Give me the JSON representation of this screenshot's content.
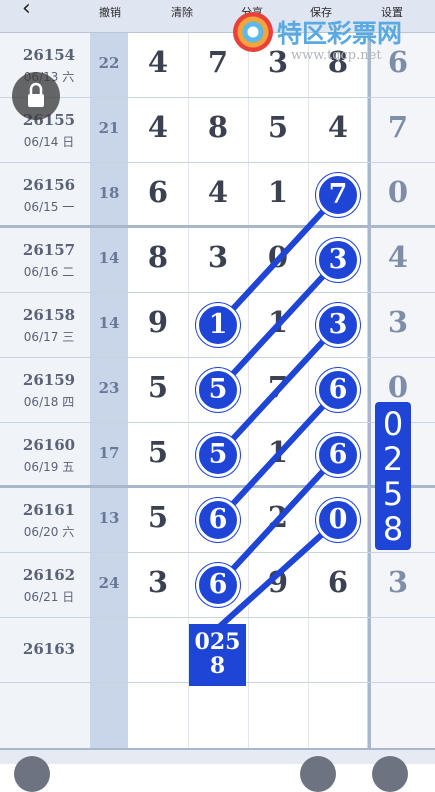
{
  "toolbar": {
    "back_symbol": "‹",
    "undo": "撤销",
    "clear": "清除",
    "share": "分享",
    "save": "保存",
    "settings": "设置"
  },
  "watermark": {
    "name": "特区彩票网",
    "url": "www.tqcp.net"
  },
  "rows": [
    {
      "issue": "26154",
      "date": "06/13 六",
      "sum": "22",
      "digits": [
        "4",
        "7",
        "3",
        "8"
      ],
      "last": "6"
    },
    {
      "issue": "26155",
      "date": "06/14 日",
      "sum": "21",
      "digits": [
        "4",
        "8",
        "5",
        "4"
      ],
      "last": "7"
    },
    {
      "issue": "26156",
      "date": "06/15 一",
      "sum": "18",
      "digits": [
        "6",
        "4",
        "1",
        "7"
      ],
      "last": "0"
    },
    {
      "issue": "26157",
      "date": "06/16 二",
      "sum": "14",
      "digits": [
        "8",
        "3",
        "0",
        "3"
      ],
      "last": "4"
    },
    {
      "issue": "26158",
      "date": "06/17 三",
      "sum": "14",
      "digits": [
        "9",
        "1",
        "1",
        "3"
      ],
      "last": "3"
    },
    {
      "issue": "26159",
      "date": "06/18 四",
      "sum": "23",
      "digits": [
        "5",
        "5",
        "7",
        "6"
      ],
      "last": "0"
    },
    {
      "issue": "26160",
      "date": "06/19 五",
      "sum": "17",
      "digits": [
        "5",
        "5",
        "1",
        "6"
      ],
      "last": ""
    },
    {
      "issue": "26161",
      "date": "06/20 六",
      "sum": "13",
      "digits": [
        "5",
        "6",
        "2",
        "0"
      ],
      "last": ""
    },
    {
      "issue": "26162",
      "date": "06/21 日",
      "sum": "24",
      "digits": [
        "3",
        "6",
        "9",
        "6"
      ],
      "last": "3"
    },
    {
      "issue": "26163",
      "date": "",
      "sum": "",
      "digits": [
        "",
        "",
        "",
        ""
      ],
      "last": ""
    }
  ],
  "prediction_box": "0258",
  "prediction_vertical": [
    "0",
    "2",
    "5",
    "8"
  ],
  "colors": {
    "accent": "#1f45d6",
    "toolbar": "#dfe6f1",
    "sum_column": "#c9d6ea"
  }
}
